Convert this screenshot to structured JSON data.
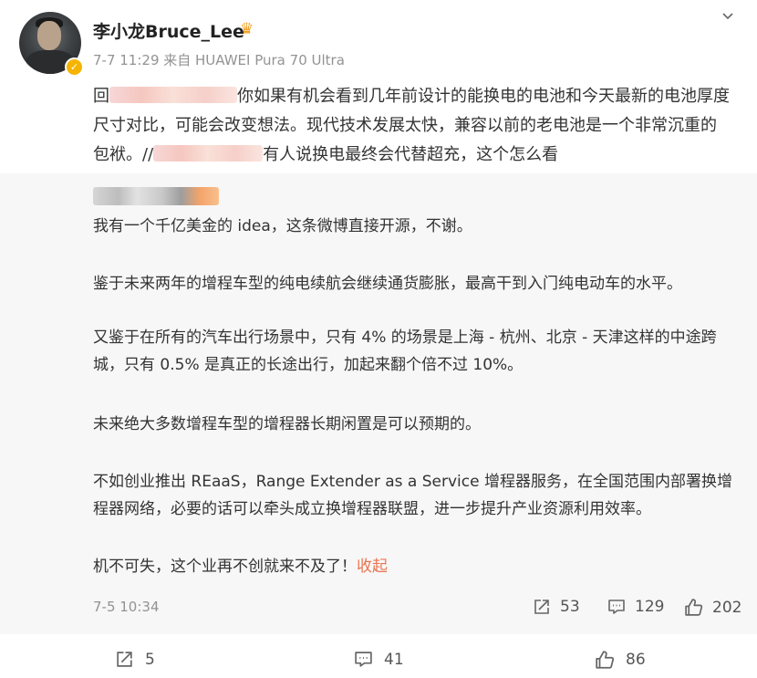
{
  "post": {
    "username": "李小龙Bruce_Lee",
    "meta": "7-7 11:29 来自 HUAWEI Pura 70 Ultra",
    "reply_prefix": "回",
    "text_part1": "你如果有机会看到几年前设计的能换电的电池和今天最新的电池厚度尺寸对比，可能会改变想法。现代技术发展太快，兼容以前的老电池是一个非常沉重的包袱。//",
    "text_part2": "有人说换电最终会代替超充，这个怎么看"
  },
  "quoted": {
    "paragraphs": [
      "我有一个千亿美金的 idea，这条微博直接开源，不谢。",
      "鉴于未来两年的增程车型的纯电续航会继续通货膨胀，最高干到入门纯电动车的水平。",
      "又鉴于在所有的汽车出行场景中，只有 4% 的场景是上海 - 杭州、北京 - 天津这样的中途跨城，只有 0.5% 是真正的长途出行，加起来翻个倍不过 10%。",
      "未来绝大多数增程车型的增程器长期闲置是可以预期的。",
      "不如创业推出 REaaS，Range Extender as a Service 增程器服务，在全国范围内部署换增程器网络，必要的话可以牵头成立换增程器联盟，进一步提升产业资源利用效率。",
      "机不可失，这个业再不创就来不及了！"
    ],
    "collapse_label": "收起",
    "date": "7-5 10:34",
    "reposts": "53",
    "comments": "129",
    "likes": "202"
  },
  "actions": {
    "reposts": "5",
    "comments": "41",
    "likes": "86"
  },
  "colors": {
    "accent": "#eb7350",
    "verified": "#f5b400",
    "quote_bg": "#f7f7f7"
  }
}
